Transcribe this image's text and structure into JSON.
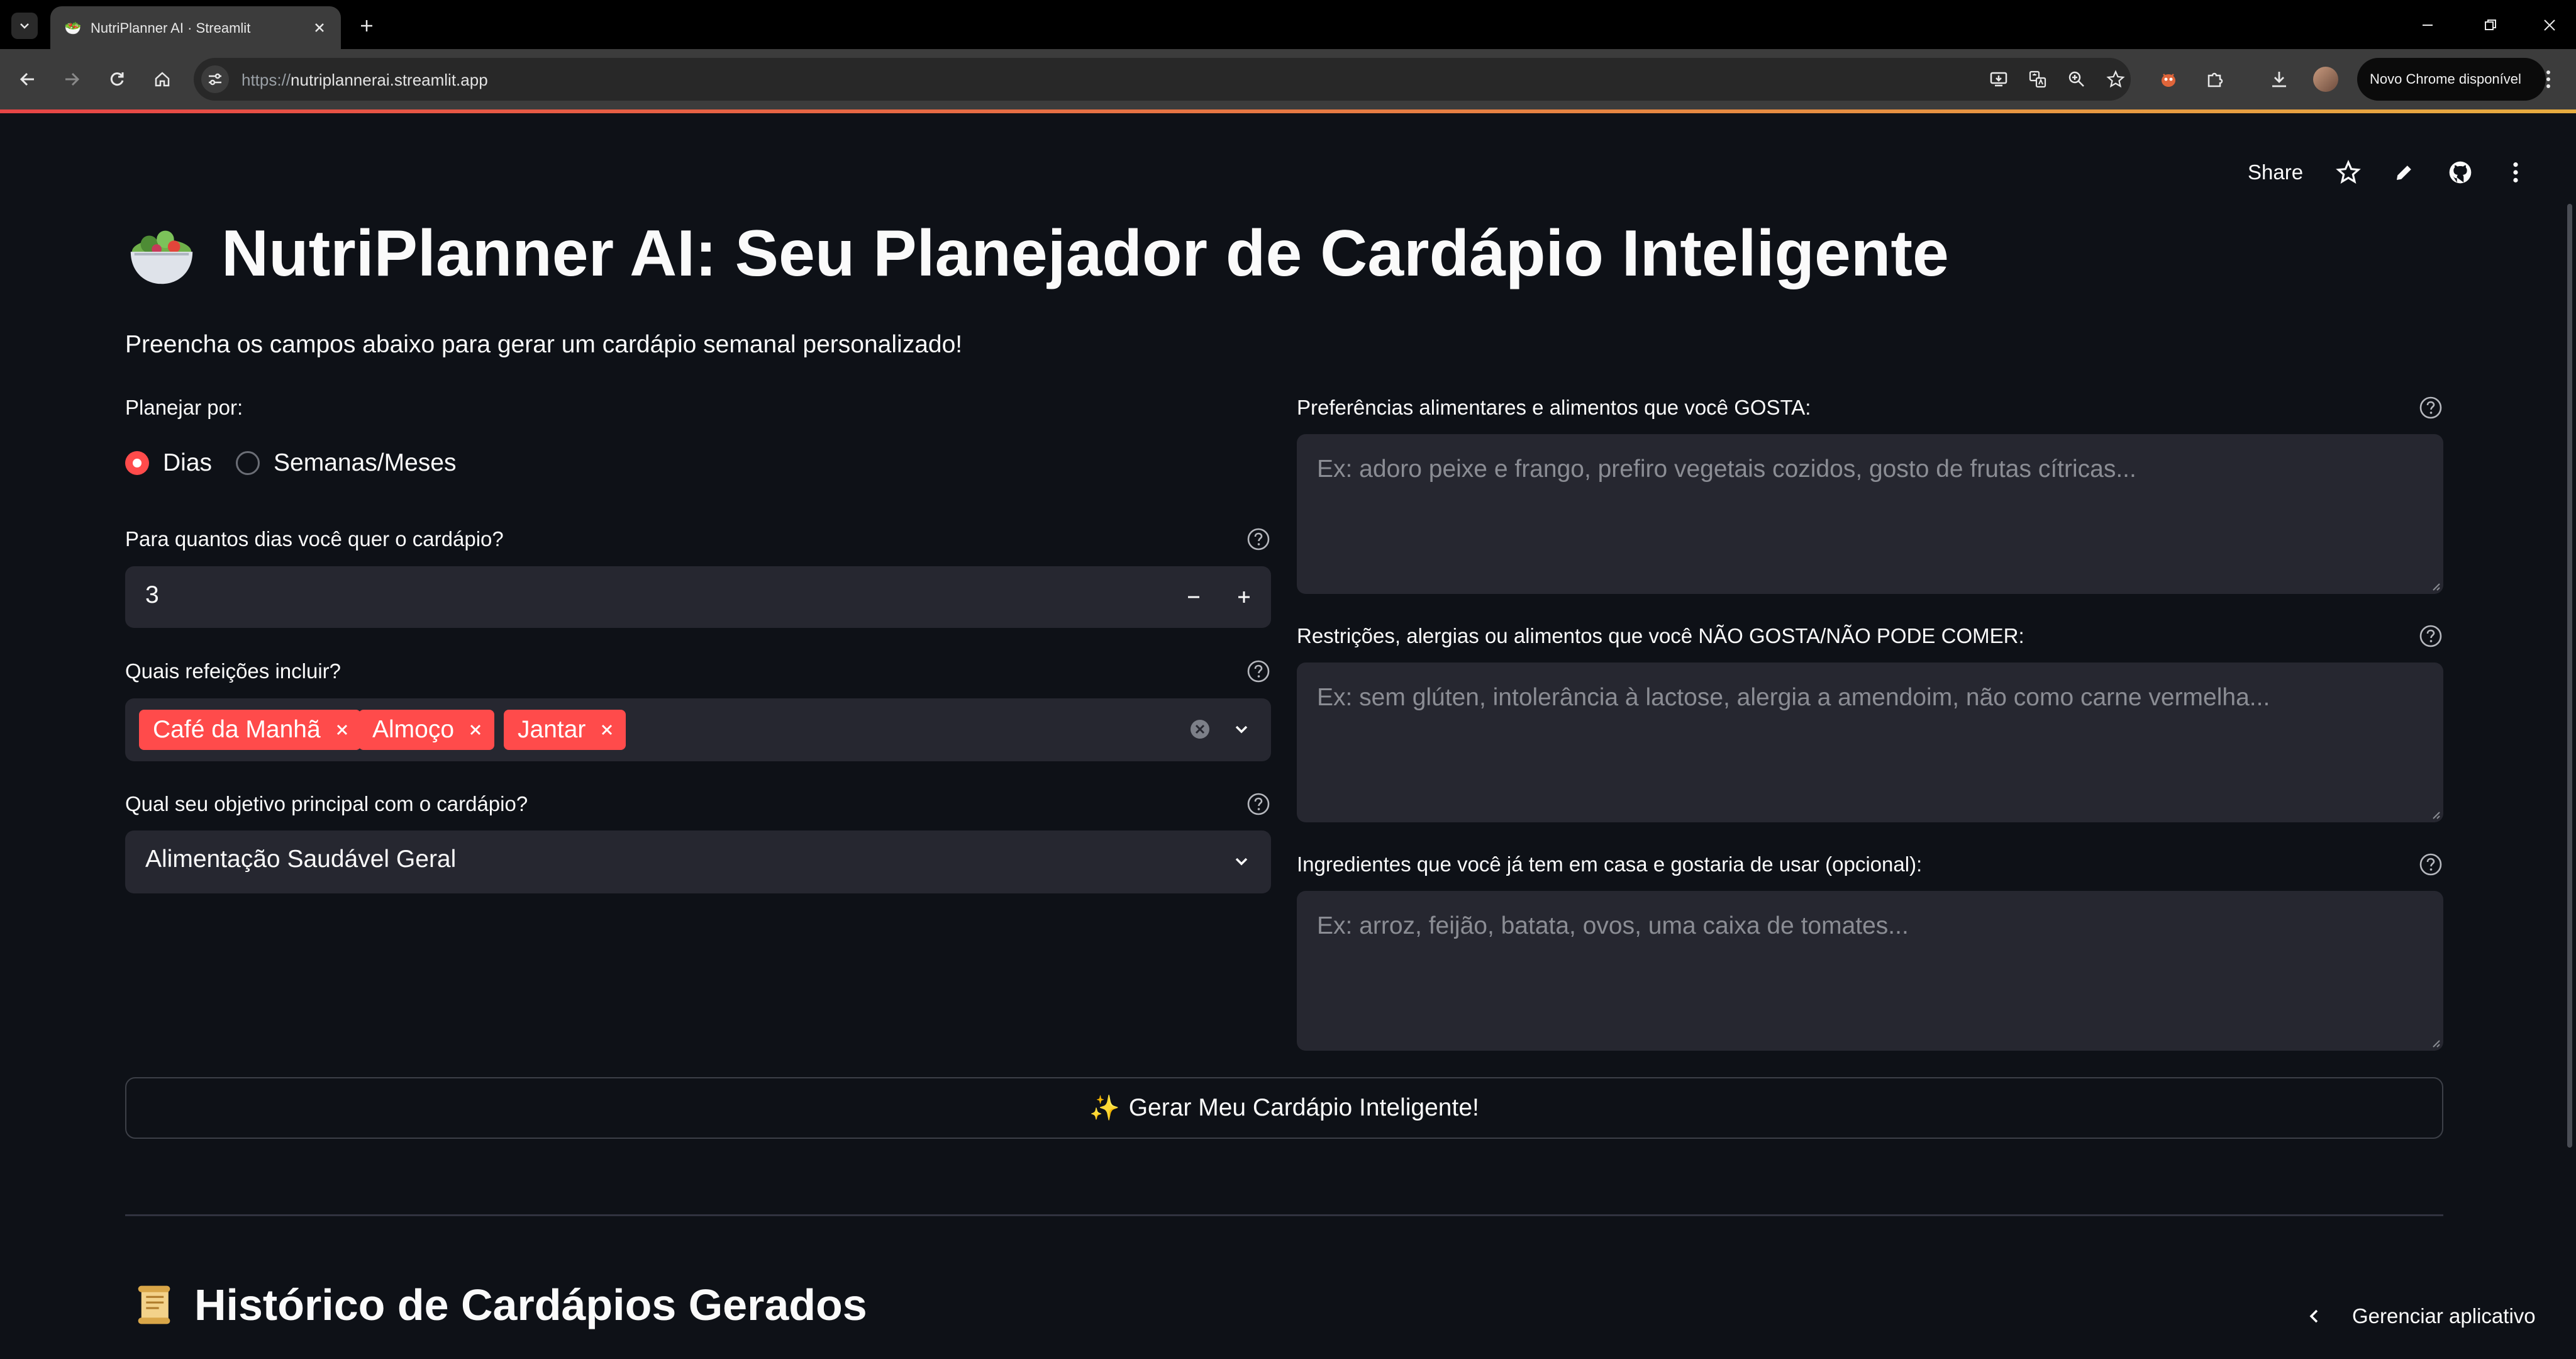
{
  "browser": {
    "tab_title": "NutriPlanner AI · Streamlit",
    "url_scheme": "https://",
    "url_host": "nutriplannerai.streamlit.app",
    "update_label": "Novo Chrome disponível"
  },
  "app": {
    "header": {
      "share_label": "Share"
    },
    "title": "NutriPlanner AI: Seu Planejador de Cardápio Inteligente",
    "subtitle": "Preencha os campos abaixo para gerar um cardápio semanal personalizado!",
    "plan_by": {
      "label": "Planejar por:",
      "options": [
        "Dias",
        "Semanas/Meses"
      ],
      "selected": "Dias"
    },
    "days": {
      "label": "Para quantos dias você quer o cardápio?",
      "value": "3"
    },
    "meals": {
      "label": "Quais refeições incluir?",
      "selected": [
        "Café da Manhã",
        "Almoço",
        "Jantar"
      ]
    },
    "goal": {
      "label": "Qual seu objetivo principal com o cardápio?",
      "value": "Alimentação Saudável Geral"
    },
    "likes": {
      "label": "Preferências alimentares e alimentos que você GOSTA:",
      "placeholder": "Ex: adoro peixe e frango, prefiro vegetais cozidos, gosto de frutas cítricas..."
    },
    "restrictions": {
      "label": "Restrições, alergias ou alimentos que você NÃO GOSTA/NÃO PODE COMER:",
      "placeholder": "Ex: sem glúten, intolerância à lactose, alergia a amendoim, não como carne vermelha..."
    },
    "ingredients": {
      "label": "Ingredientes que você já tem em casa e gostaria de usar (opcional):",
      "placeholder": "Ex: arroz, feijão, batata, ovos, uma caixa de tomates..."
    },
    "generate_label": "Gerar Meu Cardápio Inteligente!",
    "history_title": "Histórico de Cardápios Gerados",
    "manage_label": "Gerenciar aplicativo"
  },
  "colors": {
    "primary": "#ff4b4b",
    "background": "#0e1117",
    "input_bg": "#262730"
  },
  "icons": {
    "title_emoji": "salad-bowl-icon",
    "history_emoji": "scroll-icon",
    "generate_emoji": "sparkles-icon"
  }
}
